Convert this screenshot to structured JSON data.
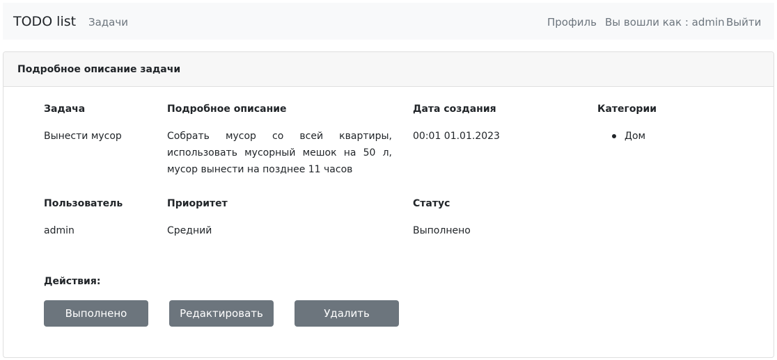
{
  "navbar": {
    "brand": "TODO list",
    "tasks_link": "Задачи",
    "profile_link": "Профиль",
    "logged_in_as": "Вы вошли как : admin",
    "logout_link": "Выйти"
  },
  "card": {
    "title": "Подробное описание задачи",
    "fields": {
      "task_label": "Задача",
      "task_value": "Вынести мусор",
      "description_label": "Подробное описание",
      "description_value": "Собрать мусор со всей квартиры, использовать мусорный мешок на 50 л, мусор вынести на позднее 11 часов",
      "created_label": "Дата создания",
      "created_value": "00:01 01.01.2023",
      "categories_label": "Категории",
      "categories": [
        "Дом"
      ],
      "user_label": "Пользователь",
      "user_value": "admin",
      "priority_label": "Приоритет",
      "priority_value": "Средний",
      "status_label": "Статус",
      "status_value": "Выполнено"
    },
    "actions": {
      "label": "Действия:",
      "done_button": "Выполнено",
      "edit_button": "Редактировать",
      "delete_button": "Удалить"
    }
  }
}
